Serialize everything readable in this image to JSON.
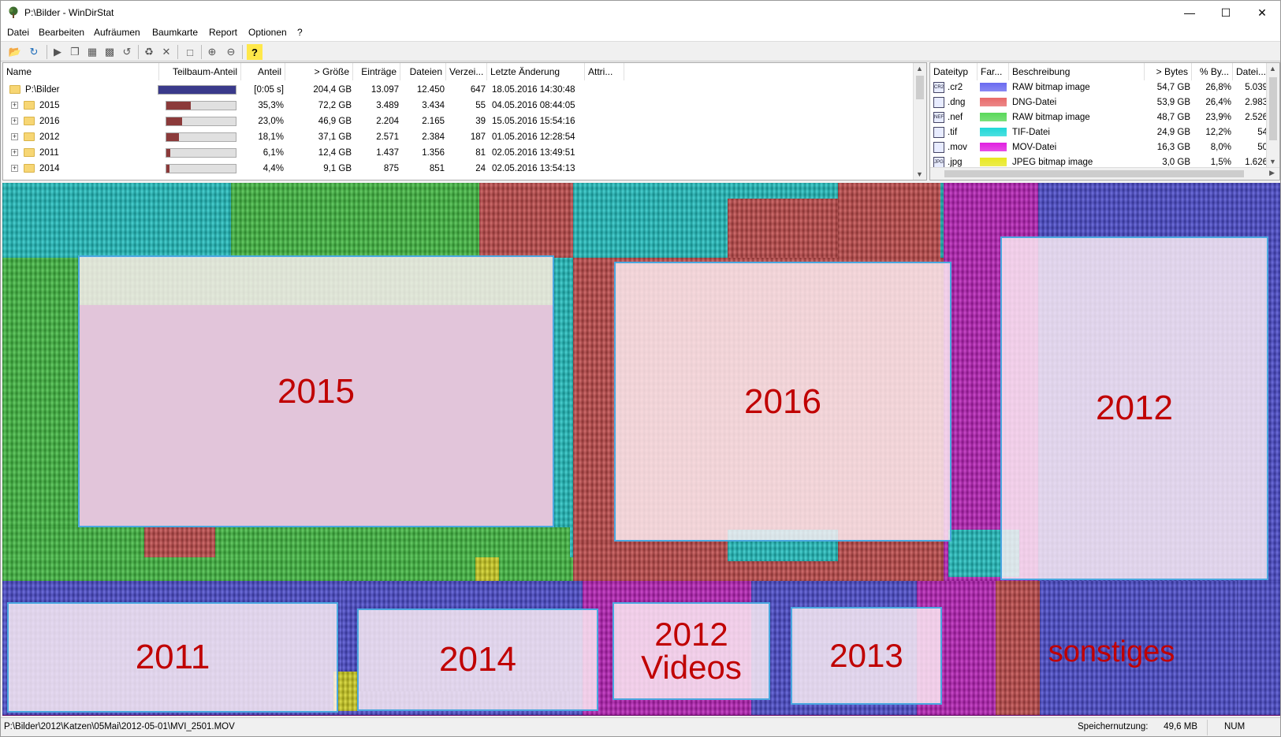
{
  "window": {
    "title": "P:\\Bilder - WinDirStat"
  },
  "menu": [
    "Datei",
    "Bearbeiten",
    "Aufräumen",
    "Baumkarte",
    "Report",
    "Optionen",
    "?"
  ],
  "tree": {
    "headers": [
      "Name",
      "Teilbaum-Anteil",
      "Anteil",
      "> Größe",
      "Einträge",
      "Dateien",
      "Verzei...",
      "Letzte Änderung",
      "Attri..."
    ],
    "rows": [
      {
        "name": "P:\\Bilder",
        "share": "[0:05 s]",
        "size": "204,4 GB",
        "entries": "13.097",
        "files": "12.450",
        "dirs": "647",
        "modified": "18.05.2016  14:30:48",
        "bar": 1.0
      },
      {
        "name": "2015",
        "share": "35,3%",
        "size": "72,2 GB",
        "entries": "3.489",
        "files": "3.434",
        "dirs": "55",
        "modified": "04.05.2016  08:44:05",
        "bar": 0.353
      },
      {
        "name": "2016",
        "share": "23,0%",
        "size": "46,9 GB",
        "entries": "2.204",
        "files": "2.165",
        "dirs": "39",
        "modified": "15.05.2016  15:54:16",
        "bar": 0.23
      },
      {
        "name": "2012",
        "share": "18,1%",
        "size": "37,1 GB",
        "entries": "2.571",
        "files": "2.384",
        "dirs": "187",
        "modified": "01.05.2016  12:28:54",
        "bar": 0.181
      },
      {
        "name": "2011",
        "share": "6,1%",
        "size": "12,4 GB",
        "entries": "1.437",
        "files": "1.356",
        "dirs": "81",
        "modified": "02.05.2016  13:49:51",
        "bar": 0.061
      },
      {
        "name": "2014",
        "share": "4,4%",
        "size": "9,1 GB",
        "entries": "875",
        "files": "851",
        "dirs": "24",
        "modified": "02.05.2016  13:54:13",
        "bar": 0.044
      }
    ]
  },
  "ext": {
    "headers": [
      "Dateityp",
      "Far...",
      "Beschreibung",
      "> Bytes",
      "% By...",
      "Datei..."
    ],
    "rows": [
      {
        "ext": ".cr2",
        "color": "#6a6af0",
        "desc": "RAW bitmap image",
        "bytes": "54,7 GB",
        "pct": "26,8%",
        "files": "5.039",
        "icon": "CR2"
      },
      {
        "ext": ".dng",
        "color": "#e86a6a",
        "desc": "DNG-Datei",
        "bytes": "53,9 GB",
        "pct": "26,4%",
        "files": "2.983",
        "icon": ""
      },
      {
        "ext": ".nef",
        "color": "#5ad85a",
        "desc": "RAW bitmap image",
        "bytes": "48,7 GB",
        "pct": "23,9%",
        "files": "2.526",
        "icon": "NEF"
      },
      {
        "ext": ".tif",
        "color": "#20d8d8",
        "desc": "TIF-Datei",
        "bytes": "24,9 GB",
        "pct": "12,2%",
        "files": "54",
        "icon": ""
      },
      {
        "ext": ".mov",
        "color": "#e020e0",
        "desc": "MOV-Datei",
        "bytes": "16,3 GB",
        "pct": "8,0%",
        "files": "50",
        "icon": ""
      },
      {
        "ext": ".jpg",
        "color": "#e8e820",
        "desc": "JPEG bitmap image",
        "bytes": "3,0 GB",
        "pct": "1,5%",
        "files": "1.626",
        "icon": "JPG"
      }
    ]
  },
  "overlays": [
    {
      "label": "2015"
    },
    {
      "label": "2016"
    },
    {
      "label": "2012"
    },
    {
      "label": "2011"
    },
    {
      "label": "2014"
    },
    {
      "label": "2012\nVideos"
    },
    {
      "label": "2013"
    },
    {
      "label": "sonstiges"
    }
  ],
  "status": {
    "path": "P:\\Bilder\\2012\\Katzen\\05Mai\\2012-05-01\\MVI_2501.MOV",
    "mem_label": "Speichernutzung:",
    "mem_value": "49,6 MB",
    "num": "NUM"
  }
}
